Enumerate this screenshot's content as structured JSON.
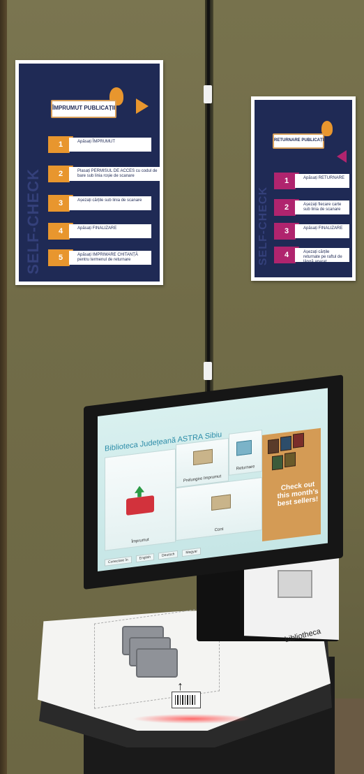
{
  "poster_left": {
    "title": "ÎMPRUMUT PUBLICAȚII",
    "vertical": "SELF-CHECK",
    "steps": [
      {
        "num": "1",
        "text": "Apăsați ÎMPRUMUT"
      },
      {
        "num": "2",
        "text": "Plasați PERMISUL DE ACCES cu codul de bare sub linia roșie de scanare"
      },
      {
        "num": "3",
        "text": "Așezați cărțile sub linia de scanare"
      },
      {
        "num": "4",
        "text": "Apăsați FINALIZARE"
      },
      {
        "num": "5",
        "text": "Apăsați IMPRIMARE CHITANȚĂ pentru termenul de returnare"
      }
    ]
  },
  "poster_right": {
    "title": "RETURNARE PUBLICAȚII",
    "vertical": "SELF-CHECK",
    "steps": [
      {
        "num": "1",
        "text": "Apăsați RETURNARE"
      },
      {
        "num": "2",
        "text": "Așezați fiecare carte sub linia de scanare"
      },
      {
        "num": "3",
        "text": "Apăsați FINALIZARE"
      },
      {
        "num": "4",
        "text": "Așezați cărțile returnate pe raftul de lângă aparat"
      }
    ]
  },
  "screen": {
    "title": "Biblioteca Județeană ASTRA Sibiu",
    "tiles": {
      "borrow": "Împrumut",
      "renew": "Prelungire împrumut",
      "return": "Returnare",
      "account": "Cont"
    },
    "ad_text": "Check out this month's best sellers!",
    "bottom_bar": [
      "Conectare în",
      "English",
      "Deutsch",
      "Magyar"
    ]
  },
  "device": {
    "brand": "bibliotheca"
  },
  "colors": {
    "wall": "#6f6a46",
    "poster_bg": "#1f2a55",
    "accent_orange": "#e8962e",
    "accent_magenta": "#b0246e",
    "screen_accent": "#2c8ca8"
  }
}
